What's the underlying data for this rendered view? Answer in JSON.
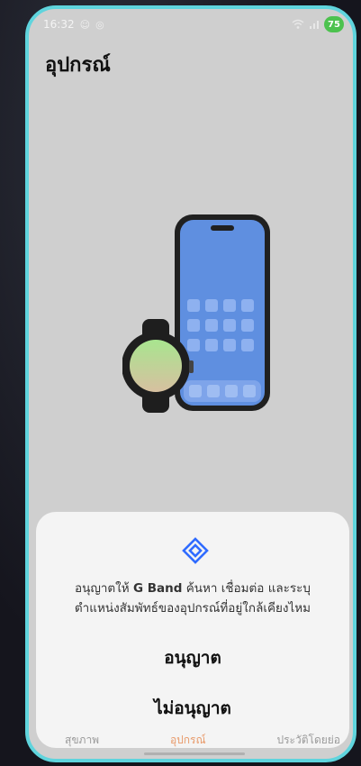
{
  "status_bar": {
    "time": "16:32",
    "left_icons": [
      "face-icon",
      "vpn-icon"
    ],
    "right_icons": [
      "wifi-icon",
      "signal-icon"
    ],
    "battery_level": "75"
  },
  "page": {
    "title": "อุปกรณ์"
  },
  "permission_sheet": {
    "icon": "nearby-diamond-icon",
    "message_before_app": "อนุญาตให้ ",
    "app_name": "G Band",
    "message_after_app": " ค้นหา เชื่อมต่อ และระบุตำแหน่งสัมพัทธ์ของอุปกรณ์ที่อยู่ใกล้เคียงไหม",
    "allow_label": "อนุญาต",
    "deny_label": "ไม่อนุญาต",
    "accent_color": "#2f6bff"
  },
  "bottom_nav": {
    "items": [
      {
        "label": "สุขภาพ",
        "active": false
      },
      {
        "label": "อุปกรณ์",
        "active": true
      },
      {
        "label": "ประวัติโดยย่อ",
        "active": false
      }
    ]
  },
  "colors": {
    "frame_border": "#5fd4dd",
    "battery_badge": "#4cc24e",
    "active_nav": "#e89a6a"
  }
}
